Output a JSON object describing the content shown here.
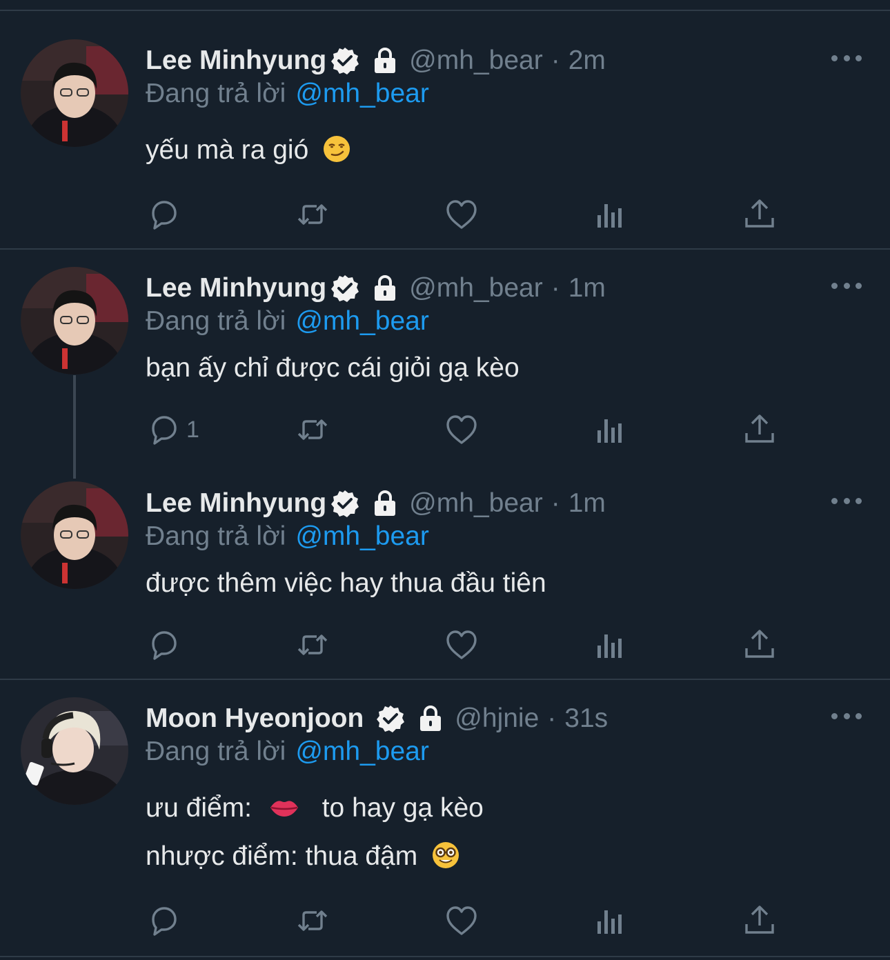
{
  "reply_prefix": "Đang trả lời",
  "tweets": [
    {
      "name": "Lee Minhyung",
      "handle": "@mh_bear",
      "separator": "·",
      "time": "2m",
      "reply_to": "@mh_bear",
      "lines": [
        "yếu mà ra gió"
      ],
      "reply_count": ""
    },
    {
      "name": "Lee Minhyung",
      "handle": "@mh_bear",
      "separator": "·",
      "time": "1m",
      "reply_to": "@mh_bear",
      "lines": [
        "bạn ấy chỉ được cái giỏi gạ kèo"
      ],
      "reply_count": "1"
    },
    {
      "name": "Lee Minhyung",
      "handle": "@mh_bear",
      "separator": "·",
      "time": "1m",
      "reply_to": "@mh_bear",
      "lines": [
        "được thêm việc hay thua đầu tiên"
      ],
      "reply_count": ""
    },
    {
      "name": "Moon Hyeonjoon",
      "handle": "@hjnie",
      "separator": "·",
      "time": "31s",
      "reply_to": "@mh_bear",
      "lines": [
        "ưu điểm:",
        "to hay gạ kèo",
        "nhược điểm: thua đậm"
      ],
      "reply_count": ""
    }
  ],
  "icons": [
    "verified-badge-icon",
    "lock-icon",
    "more-icon",
    "reply-icon",
    "retweet-icon",
    "like-icon",
    "views-icon",
    "share-icon",
    "smirk-emoji-icon",
    "lips-emoji-icon",
    "nerd-emoji-icon"
  ],
  "colors": {
    "background": "#16202b",
    "text": "#e7e9ea",
    "muted": "#71808e",
    "link": "#1d9bf0",
    "separator": "#2f3b47"
  }
}
